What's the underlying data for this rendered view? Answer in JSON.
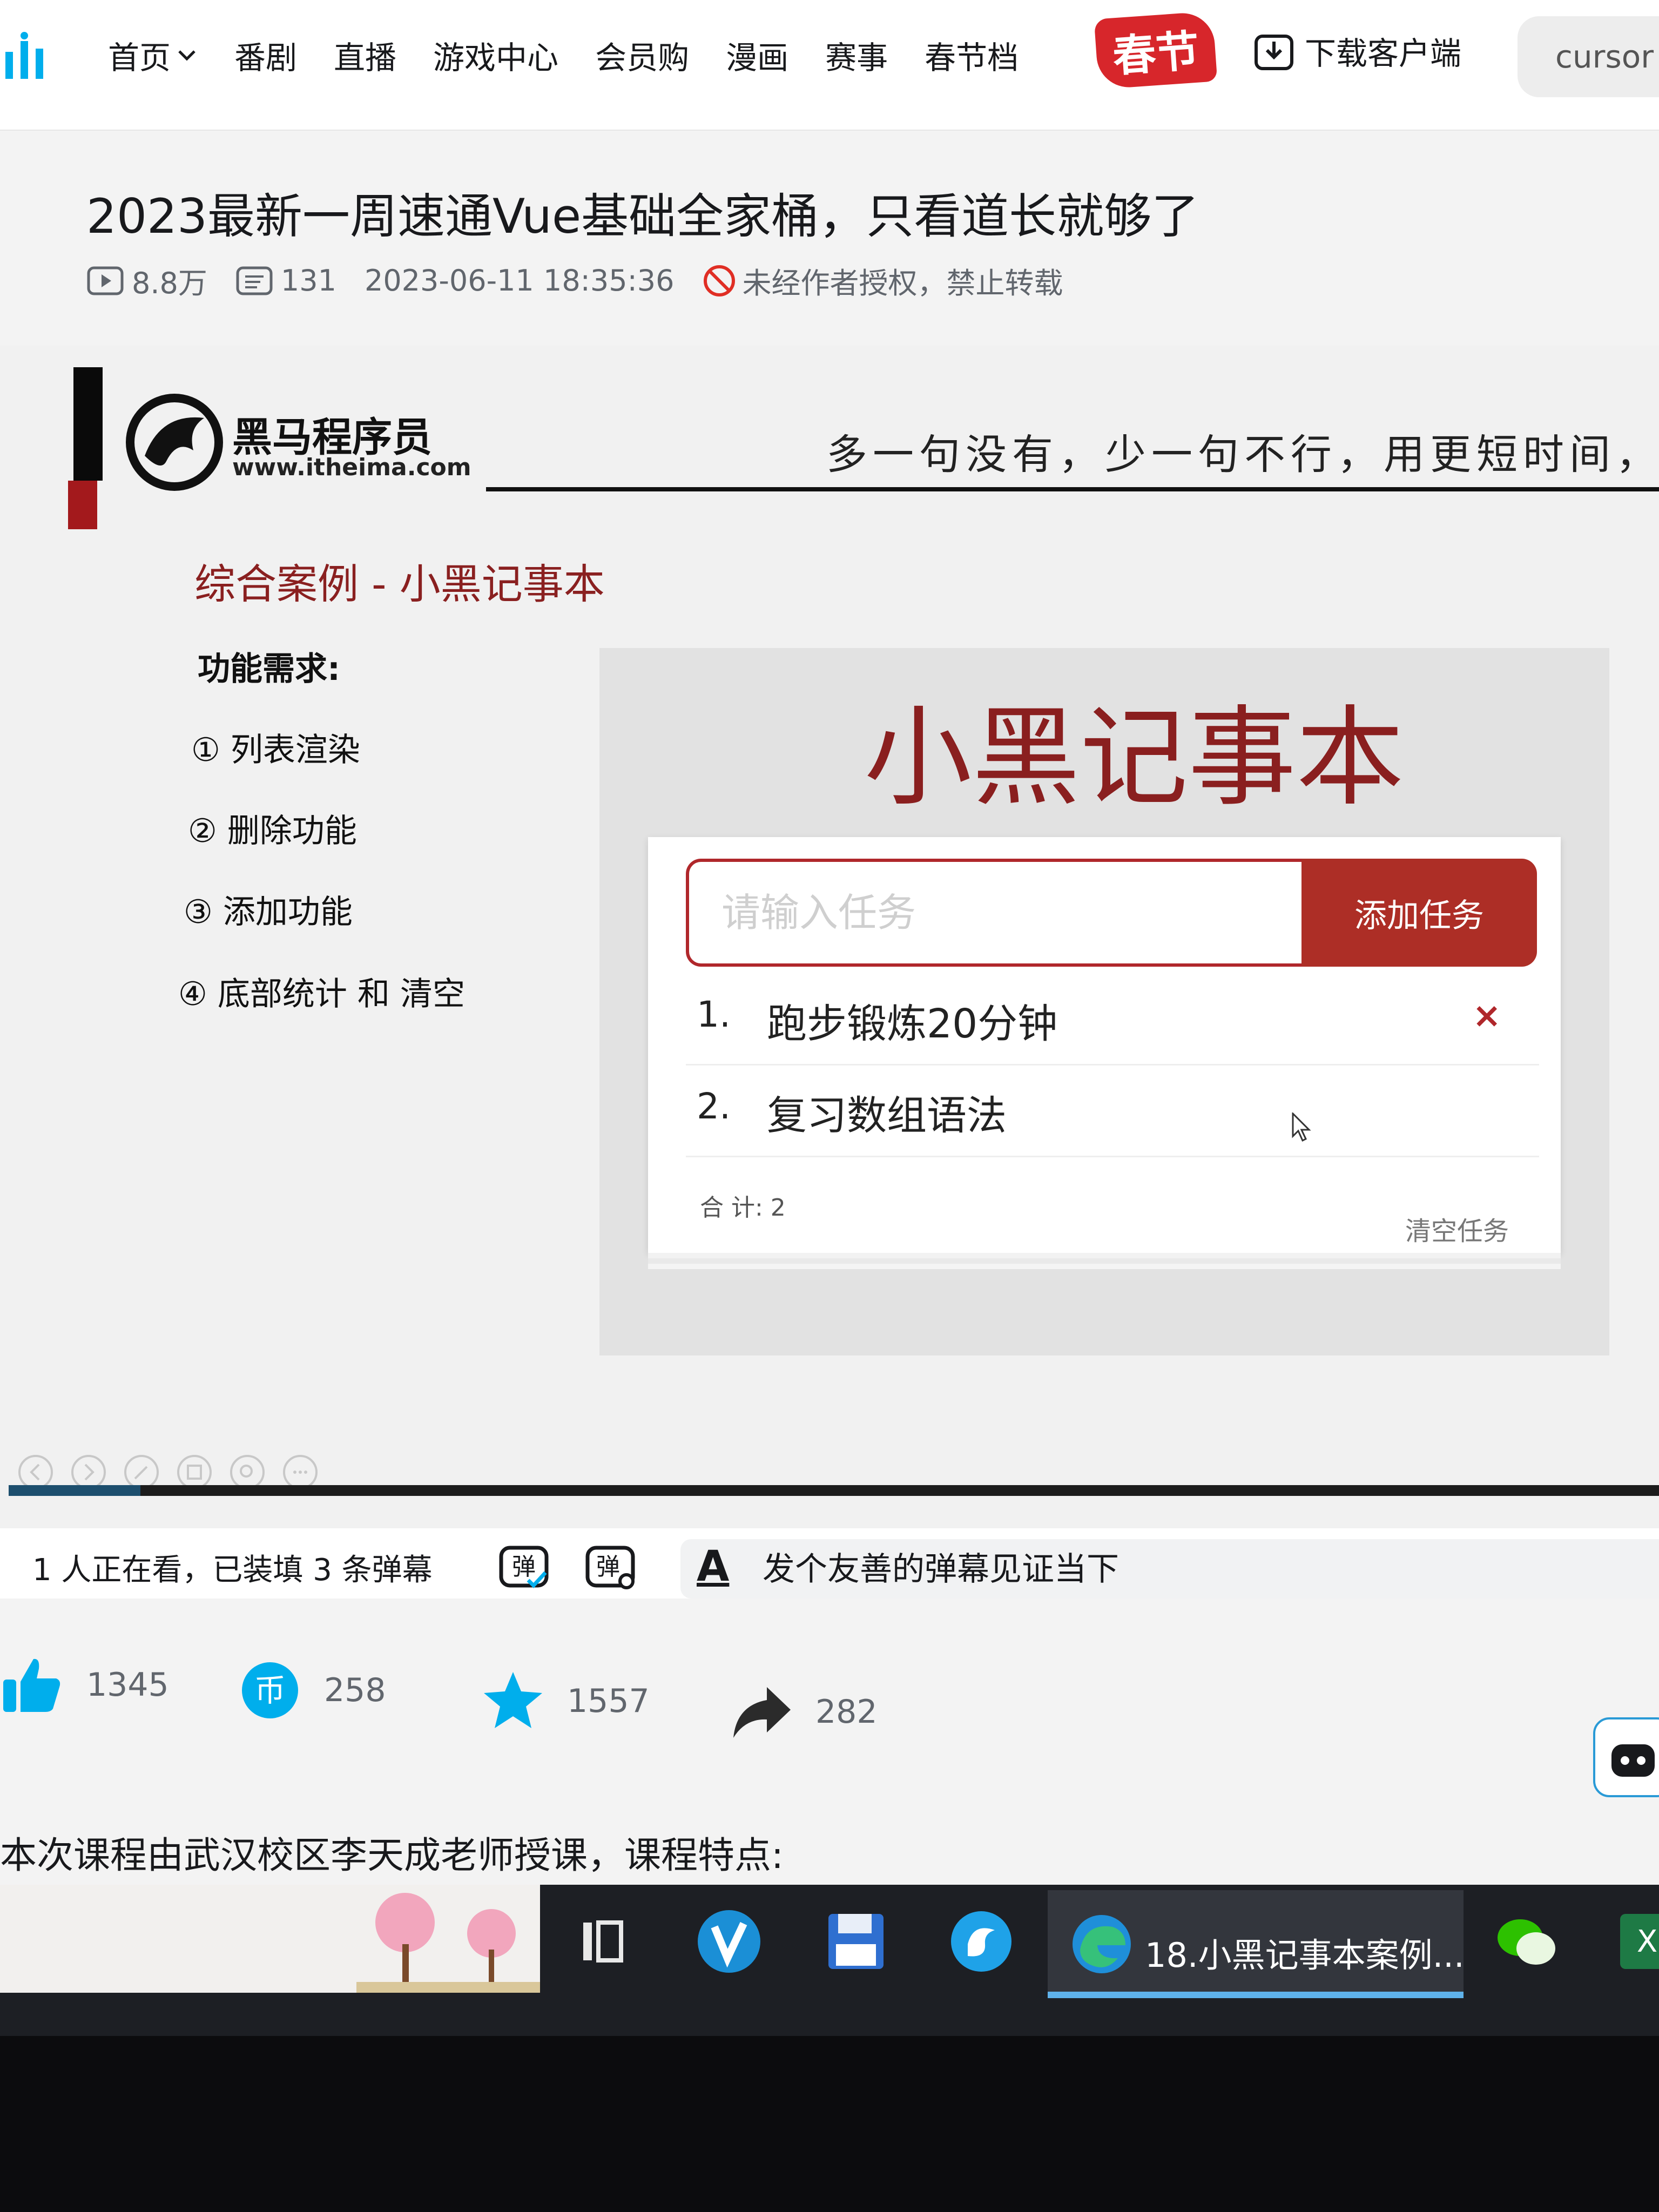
{
  "nav": {
    "items": [
      "首页",
      "番剧",
      "直播",
      "游戏中心",
      "会员购",
      "漫画",
      "赛事",
      "春节档"
    ],
    "festival_badge": "春节",
    "download_label": "下载客户端",
    "search_text": "cursor"
  },
  "video": {
    "title": "2023最新一周速通Vue基础全家桶，只看道长就够了",
    "views": "8.8万",
    "danmaku_count": "131",
    "publish_time": "2023-06-11 18:35:36",
    "copyright_notice": "未经作者授权，禁止转载"
  },
  "slide": {
    "brand_name": "黑马程序员",
    "brand_url": "www.itheima.com",
    "slogan": "多一句没有，少一句不行，用更短时间，",
    "case_title": "综合案例 - 小黑记事本",
    "requirements_title": "功能需求:",
    "requirements": [
      "① 列表渲染",
      "② 删除功能",
      "③ 添加功能",
      "④ 底部统计 和 清空"
    ],
    "demo": {
      "heading": "小黑记事本",
      "input_placeholder": "请输入任务",
      "add_button": "添加任务",
      "tasks": [
        {
          "num": "1.",
          "text": "跑步锻炼20分钟",
          "delete": "×"
        },
        {
          "num": "2.",
          "text": "复习数组语法"
        }
      ],
      "total": "合 计: 2",
      "clear_button": "清空任务"
    },
    "progress": 0.08
  },
  "danmaku": {
    "viewers": "1 人正在看，已装填 3 条弹幕",
    "font_icon": "A",
    "input_placeholder": "发个友善的弹幕见证当下"
  },
  "actions": {
    "likes": "1345",
    "coins": "258",
    "favorites": "1557",
    "shares": "282"
  },
  "description": "本次课程由武汉校区李天成老师授课，课程特点:",
  "taskbar": {
    "active_window": "18.小黑记事本案例..."
  },
  "colors": {
    "brand_red": "#ad2e26",
    "bili_blue": "#00aeec",
    "heading_red": "#8a1f1f"
  }
}
